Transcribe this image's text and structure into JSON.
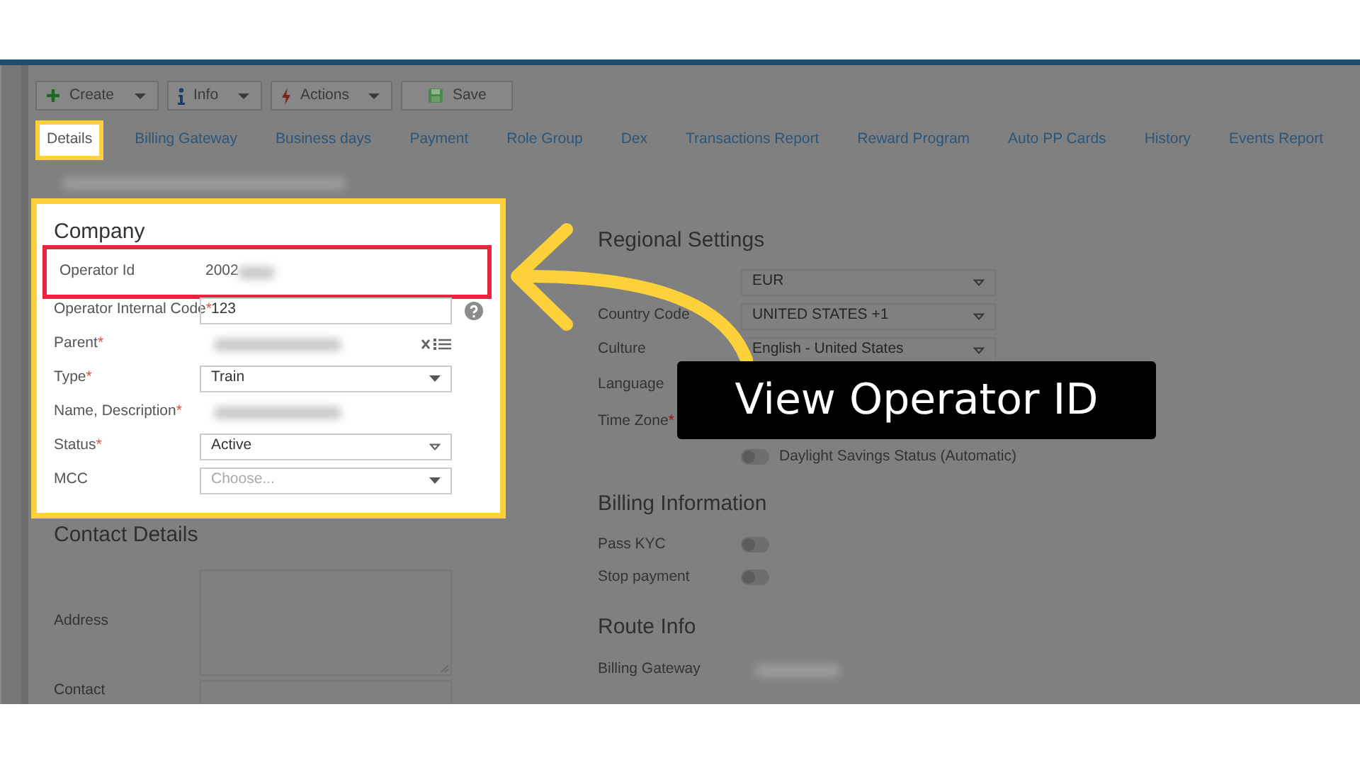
{
  "toolbar": [
    {
      "kind": "create",
      "label": "Create"
    },
    {
      "kind": "info",
      "label": "Info"
    },
    {
      "kind": "actions",
      "label": "Actions"
    },
    {
      "kind": "save",
      "label": "Save"
    }
  ],
  "tabs": [
    {
      "label": "Details",
      "selected": true
    },
    {
      "label": "Billing Gateway",
      "selected": false
    },
    {
      "label": "Business days",
      "selected": false
    },
    {
      "label": "Payment",
      "selected": false
    },
    {
      "label": "Role Group",
      "selected": false
    },
    {
      "label": "Dex",
      "selected": false
    },
    {
      "label": "Transactions Report",
      "selected": false
    },
    {
      "label": "Reward Program",
      "selected": false
    },
    {
      "label": "Auto PP Cards",
      "selected": false
    },
    {
      "label": "History",
      "selected": false
    },
    {
      "label": "Events Report",
      "selected": false
    }
  ],
  "record_title": {
    "redacted": true
  },
  "company": {
    "title": "Company",
    "highlighted": true,
    "fields": [
      {
        "kind": "readonly",
        "label": "Operator Id",
        "value": "2002",
        "redacted": true,
        "highlighted": true
      },
      {
        "kind": "input",
        "label": "Operator Internal Code",
        "asterisk": "*",
        "value": "123",
        "help": true
      },
      {
        "kind": "lookup",
        "label": "Parent",
        "asterisk": "*",
        "redacted": true
      },
      {
        "kind": "dropdown",
        "label": "Type",
        "asterisk": "*",
        "value": "Train"
      },
      {
        "kind": "readonly",
        "label": "Name, Description",
        "asterisk": "*",
        "redacted": true
      },
      {
        "kind": "select",
        "label": "Status",
        "asterisk": "*",
        "value": "Active"
      },
      {
        "kind": "dropdown",
        "label": "MCC",
        "placeholder": "Choose..."
      }
    ]
  },
  "contact": {
    "title": "Contact Details",
    "fields": [
      {
        "kind": "textarea",
        "label": "Address"
      },
      {
        "kind": "input",
        "label": "Contact"
      }
    ]
  },
  "regional": {
    "title": "Regional Settings",
    "fields": [
      {
        "kind": "select",
        "value": "EUR"
      },
      {
        "kind": "select",
        "label": "Country Code",
        "value": "UNITED STATES +1"
      },
      {
        "kind": "select",
        "label": "Culture",
        "value": "English - United States"
      },
      {
        "kind": "label",
        "label": "Language"
      },
      {
        "kind": "label",
        "label": "Time Zone",
        "asterisk": "*"
      },
      {
        "kind": "toggle",
        "text": "Daylight Savings Status (Automatic)",
        "on": false
      }
    ]
  },
  "billing": {
    "title": "Billing Information",
    "fields": [
      {
        "kind": "toggle",
        "label": "Pass KYC",
        "on": false
      },
      {
        "kind": "toggle",
        "label": "Stop payment",
        "on": false
      }
    ]
  },
  "route": {
    "title": "Route Info",
    "fields": [
      {
        "kind": "readonly",
        "label": "Billing Gateway",
        "redacted": true
      }
    ]
  },
  "callout": {
    "text": "View Operator ID"
  }
}
